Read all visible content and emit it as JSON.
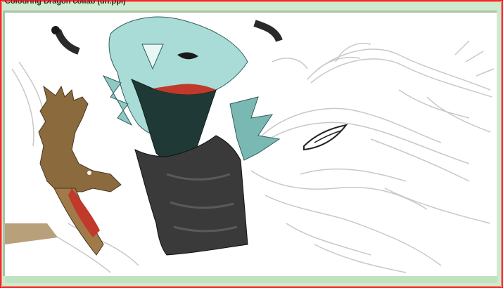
{
  "window": {
    "title": "Colouring Dragon collab (un.ppi)"
  },
  "colors": {
    "frame_red": "#ff0000",
    "window_bg": "#cfe9cf",
    "canvas_border": "#a9c3a9",
    "sketch_gray": "#c8c8c8",
    "teal_dragon": "#8fc9c4",
    "brown_dragon": "#8b6a3e",
    "dark_body": "#3a3a3a",
    "mouth_red": "#c0392b"
  },
  "icons": {
    "artwork": "drawing-canvas"
  }
}
